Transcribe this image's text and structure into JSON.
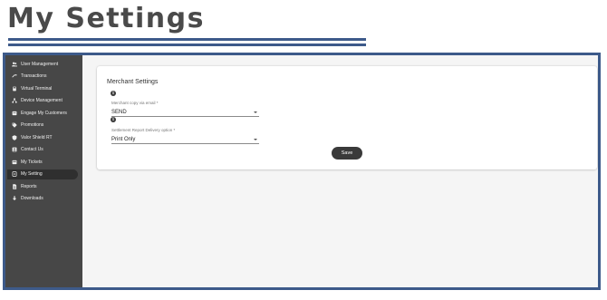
{
  "page": {
    "title": "My Settings"
  },
  "colors": {
    "accent": "#3d5a8a",
    "sidebar": "#474747",
    "button": "#3a3a3a"
  },
  "sidebar": {
    "items": [
      {
        "label": "User Management",
        "icon": "users-icon",
        "active": false
      },
      {
        "label": "Transactions",
        "icon": "arrows-icon",
        "active": false
      },
      {
        "label": "Virtual Terminal",
        "icon": "terminal-icon",
        "active": false
      },
      {
        "label": "Device Management",
        "icon": "devices-icon",
        "active": false
      },
      {
        "label": "Engage My Customers",
        "icon": "engage-icon",
        "active": false
      },
      {
        "label": "Promotions",
        "icon": "tag-icon",
        "active": false
      },
      {
        "label": "Valor Shield RT",
        "icon": "shield-icon",
        "active": false
      },
      {
        "label": "Contact Us",
        "icon": "contact-icon",
        "active": false
      },
      {
        "label": "My Tickets",
        "icon": "ticket-icon",
        "active": false
      },
      {
        "label": "My Setting",
        "icon": "settings-icon",
        "active": true
      },
      {
        "label": "Reports",
        "icon": "document-icon",
        "active": false
      },
      {
        "label": "Downloads",
        "icon": "download-icon",
        "active": false
      }
    ]
  },
  "card": {
    "title": "Merchant Settings",
    "info_icon": "i",
    "fields": [
      {
        "label": "Merchant copy via email *",
        "value": "SEND"
      },
      {
        "label": "Settlement Report Delivery option *",
        "value": "Print Only"
      }
    ],
    "save_label": "Save"
  }
}
